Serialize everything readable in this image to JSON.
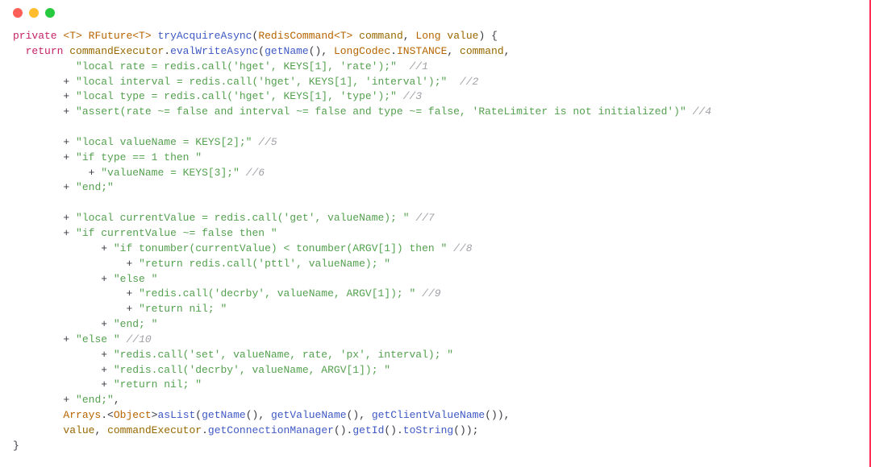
{
  "t": {
    "private": "private",
    "return": "return",
    "gT": "<T>",
    "RFuture": "RFuture",
    "tryAcquireAsync": "tryAcquireAsync",
    "RedisCommand": "RedisCommand",
    "command": "command",
    "Long": "Long",
    "value": "value",
    "commandExecutor": "commandExecutor",
    "evalWriteAsync": "evalWriteAsync",
    "getName": "getName",
    "LongCodec": "LongCodec",
    "INSTANCE": "INSTANCE",
    "Arrays": "Arrays",
    "Object": "Object",
    "asList": "asList",
    "getValueName": "getValueName",
    "getClientValueName": "getClientValueName",
    "getConnectionManager": "getConnectionManager",
    "getId": "getId",
    "toString": "toString",
    "lp": "(",
    "rp": ")",
    "lprp": "()",
    "lb": "{",
    "rb": "}",
    "lt": "<",
    "gt": ">",
    "comma": ",",
    "dot": ".",
    "semi": ";",
    "plus": "+"
  },
  "s": {
    "l1": "\"local rate = redis.call('hget', KEYS[1], 'rate');\"",
    "l2": "\"local interval = redis.call('hget', KEYS[1], 'interval');\"",
    "l3": "\"local type = redis.call('hget', KEYS[1], 'type');\"",
    "l4": "\"assert(rate ~= false and interval ~= false and type ~= false, 'RateLimiter is not initialized')\"",
    "l5": "\"local valueName = KEYS[2];\"",
    "l6": "\"if type == 1 then \"",
    "l7": "\"valueName = KEYS[3];\"",
    "l8": "\"end;\"",
    "l9": "\"local currentValue = redis.call('get', valueName); \"",
    "l10": "\"if currentValue ~= false then \"",
    "l11": "\"if tonumber(currentValue) < tonumber(ARGV[1]) then \"",
    "l12": "\"return redis.call('pttl', valueName); \"",
    "l13": "\"else \"",
    "l14": "\"redis.call('decrby', valueName, ARGV[1]); \"",
    "l15": "\"return nil; \"",
    "l16": "\"end; \"",
    "l17": "\"else \"",
    "l18": "\"redis.call('set', valueName, rate, 'px', interval); \"",
    "l19": "\"redis.call('decrby', valueName, ARGV[1]); \"",
    "l20": "\"return nil; \"",
    "l21": "\"end;\""
  },
  "c": {
    "c1": "//1",
    "c2": "//2",
    "c3": "//3",
    "c4": "//4",
    "c5": "//5",
    "c6": "//6",
    "c7": "//7",
    "c8": "//8",
    "c9": "//9",
    "c10": "//10"
  }
}
